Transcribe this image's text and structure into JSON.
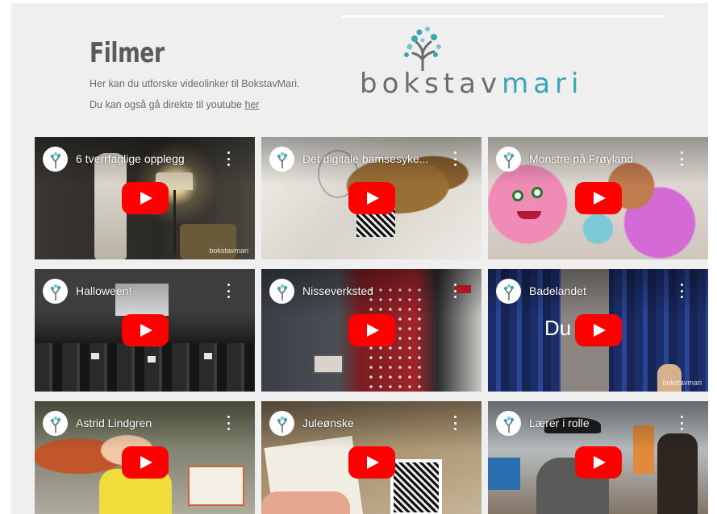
{
  "header": {
    "title": "Filmer",
    "intro_line1": "Her kan du utforske videolinker til BokstavMari.",
    "intro_line2_prefix": "Du kan også gå direkte til youtube ",
    "intro_link": "her"
  },
  "logo": {
    "text_part1": "bokstav",
    "text_part2": "mari",
    "colors": {
      "grey": "#6a6d70",
      "teal": "#3aa6b3"
    }
  },
  "videos": [
    {
      "title": "6 tverrfaglige opplegg",
      "watermark": "bokstavmari"
    },
    {
      "title": "Det digitale bamsesyke...",
      "watermark": ""
    },
    {
      "title": "Monstre på Frøyland",
      "watermark": ""
    },
    {
      "title": "Halloween!",
      "watermark": ""
    },
    {
      "title": "Nisseverksted",
      "watermark": ""
    },
    {
      "title": "Badelandet",
      "watermark": "bokstavmari",
      "overlay": "Du      ørst"
    },
    {
      "title": "Astrid Lindgren",
      "watermark": ""
    },
    {
      "title": "Juleønske",
      "watermark": ""
    },
    {
      "title": "Lærer i rolle",
      "watermark": ""
    }
  ],
  "icons": {
    "play": "youtube-play-icon",
    "more": "kebab-menu-icon",
    "channel": "bokstavmari-tree-avatar"
  },
  "colors": {
    "play_red": "#ff0000",
    "page_bg": "#efefef",
    "title_grey": "#5a5a5a"
  }
}
